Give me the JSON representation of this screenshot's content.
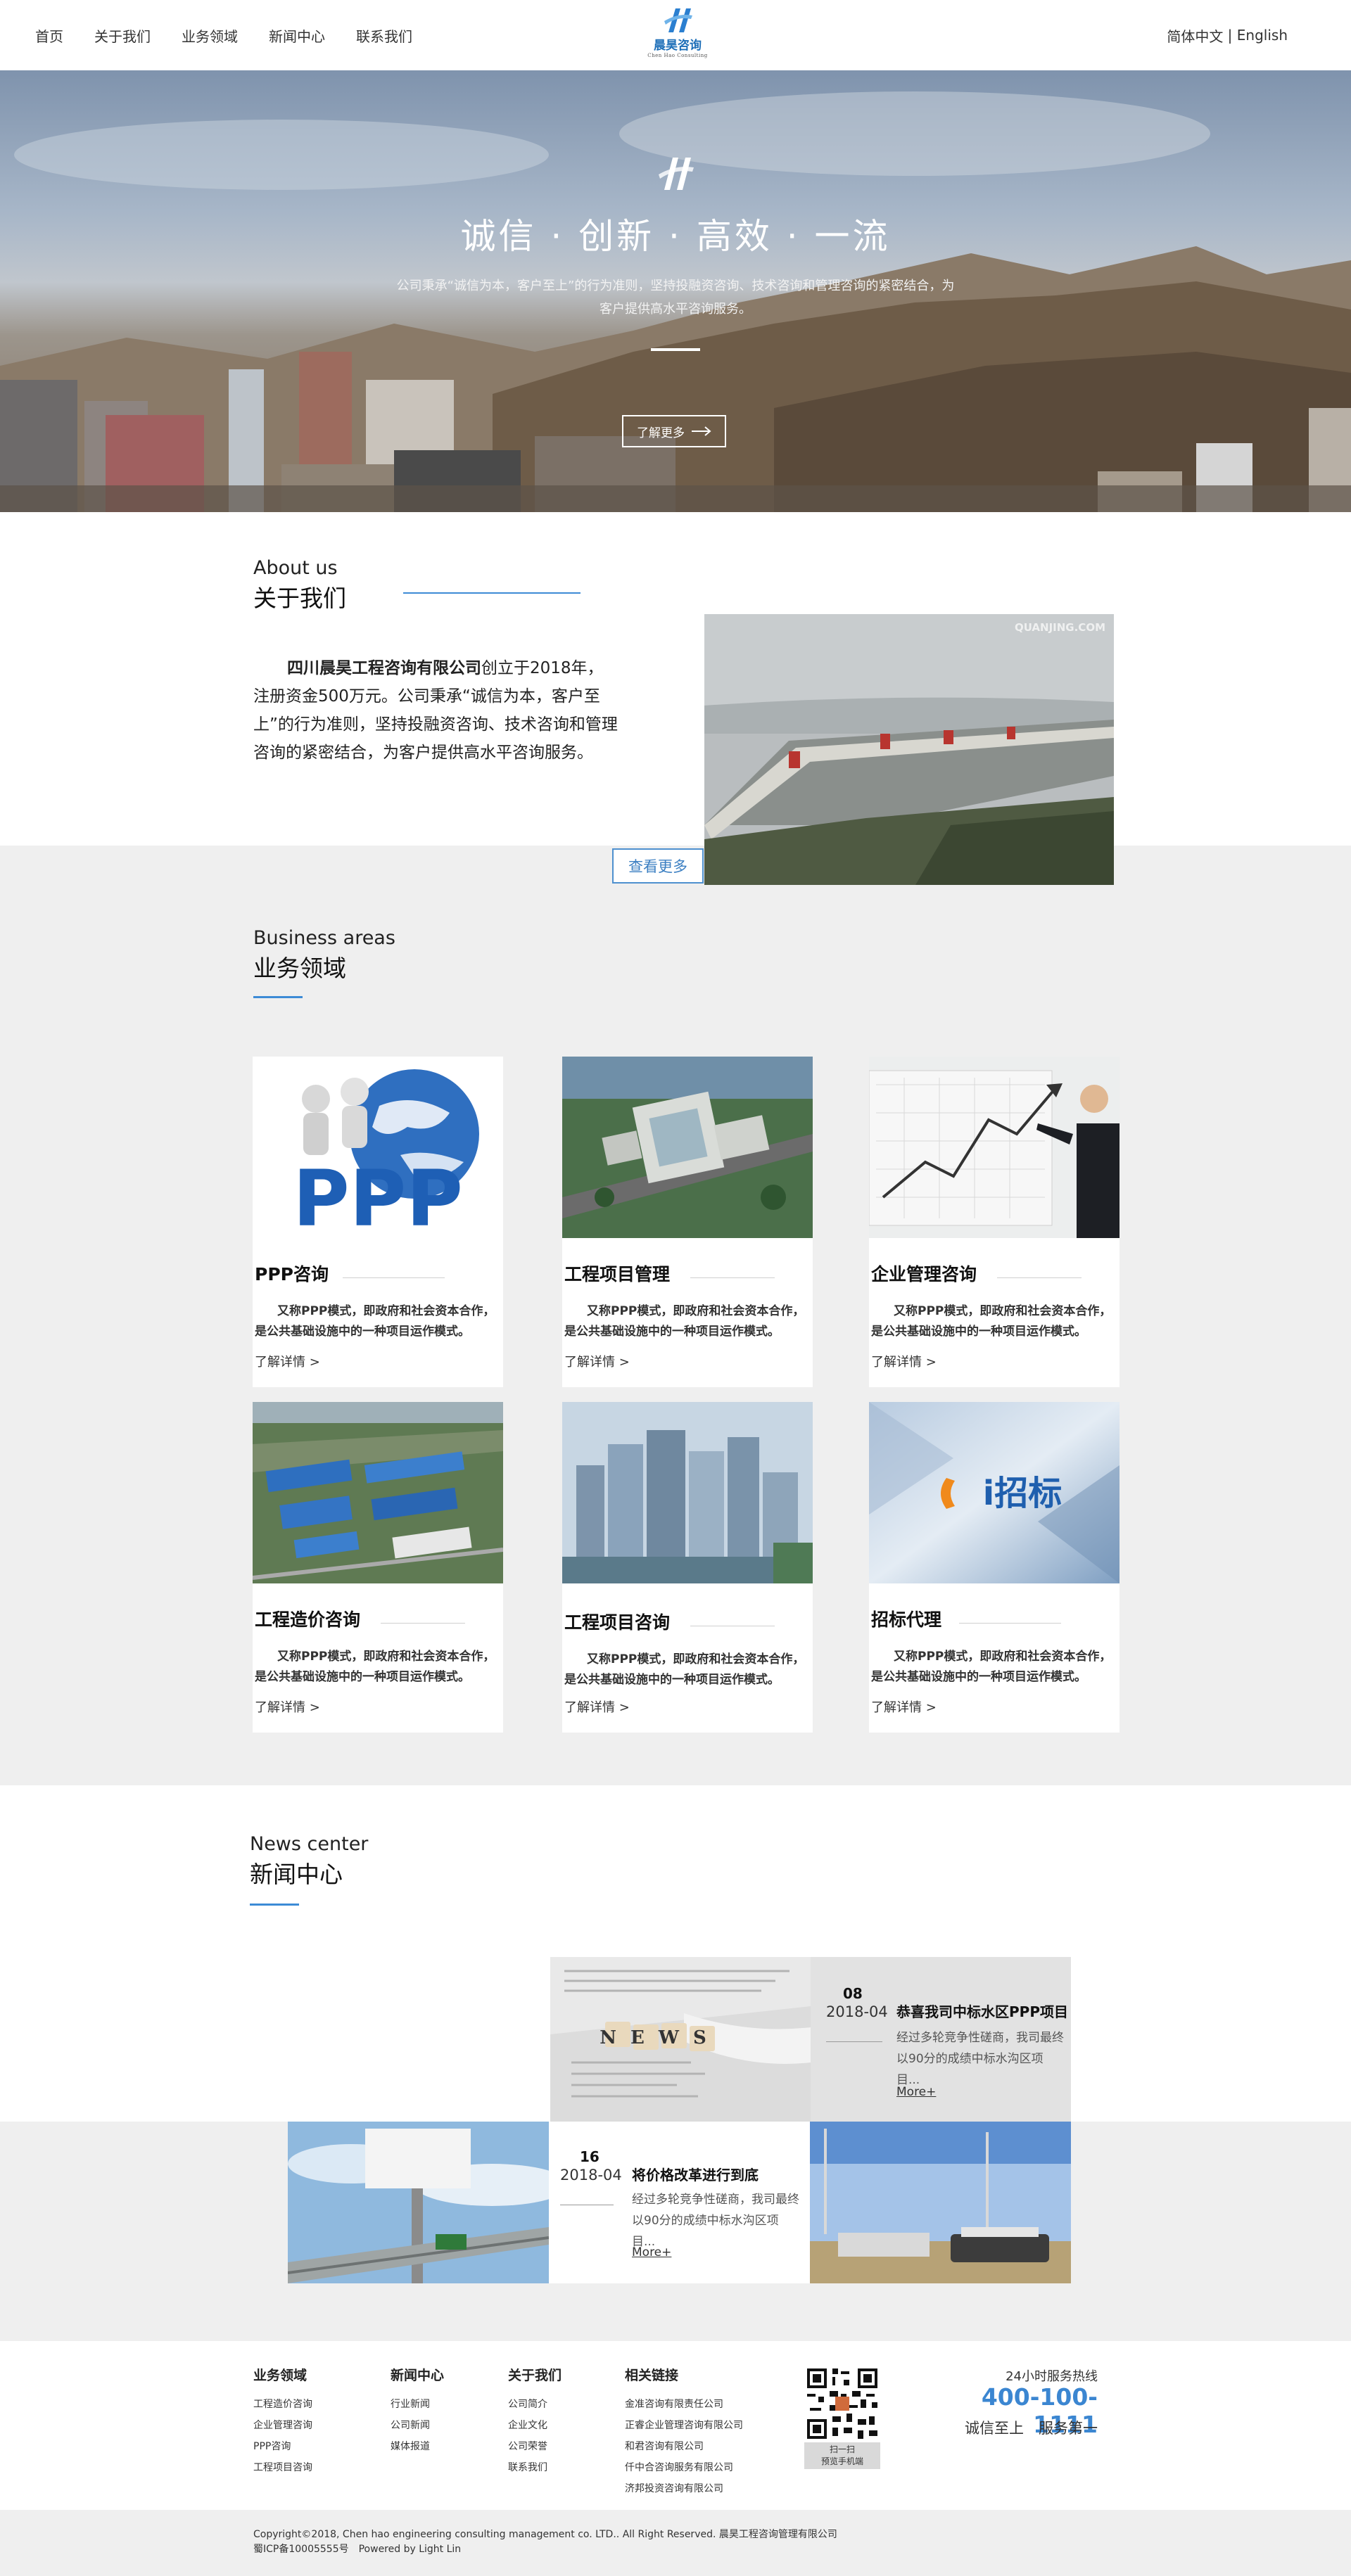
{
  "header": {
    "nav": [
      "首页",
      "关于我们",
      "业务领域",
      "新闻中心",
      "联系我们"
    ],
    "logo_text": "晨昊咨询",
    "logo_sub": "Chen Hao Consulting",
    "lang_cn": "简体中文",
    "lang_sep": " | ",
    "lang_en": "English"
  },
  "hero": {
    "title": "诚信 · 创新 · 高效 · 一流",
    "desc": "公司秉承“诚信为本，客户至上”的行为准则，坚持投融资咨询、技术咨询和管理咨询的紧密结合，为客户提供高水平咨询服务。",
    "button": "了解更多"
  },
  "about": {
    "en": "About us",
    "cn": "关于我们",
    "company": "四川晨昊工程咨询有限公司",
    "text": "创立于2018年，注册资金500万元。公司秉承“诚信为本，客户至上”的行为准则，坚持投融资咨询、技术咨询和管理咨询的紧密结合，为客户提供高水平咨询服务。",
    "watermark": "QUANJING.COM",
    "more": "查看更多"
  },
  "business": {
    "en": "Business areas",
    "cn": "业务领域",
    "desc": "又称PPP模式，即政府和社会资本合作，是公共基础设施中的一种项目运作模式。",
    "link": "了解详情 >",
    "cards": [
      {
        "title": "PPP咨询"
      },
      {
        "title": "工程项目管理"
      },
      {
        "title": "企业管理咨询"
      },
      {
        "title": "工程造价咨询"
      },
      {
        "title": "工程项目咨询"
      },
      {
        "title": "招标代理"
      }
    ],
    "ppp_text": "PPP",
    "bid_text": "i招标"
  },
  "news": {
    "en": "News center",
    "cn": "新闻中心",
    "img_word": "NEWS",
    "items": [
      {
        "day": "08",
        "month": "2018-04",
        "title": "恭喜我司中标水区PPP项目",
        "summary": "经过多轮竞争性磋商，我司最终以90分的成绩中标水沟区项目...",
        "more": "More+"
      },
      {
        "day": "16",
        "month": "2018-04",
        "title": "将价格改革进行到底",
        "summary": "经过多轮竞争性磋商，我司最终以90分的成绩中标水沟区项目...",
        "more": "More+"
      }
    ]
  },
  "footer": {
    "cols": [
      {
        "title": "业务领域",
        "items": [
          "工程造价咨询",
          "企业管理咨询",
          "PPP咨询",
          "工程项目咨询"
        ]
      },
      {
        "title": "新闻中心",
        "items": [
          "行业新闻",
          "公司新闻",
          "媒体报道"
        ]
      },
      {
        "title": "关于我们",
        "items": [
          "公司简介",
          "企业文化",
          "公司荣誉",
          "联系我们"
        ]
      },
      {
        "title": "相关链接",
        "items": [
          "金准咨询有限责任公司",
          "正睿企业管理咨询有限公司",
          "和君咨询有限公司",
          "仟中合咨询服务有限公司",
          "济邦投资咨询有限公司"
        ]
      }
    ],
    "qr_caption1": "扫一扫",
    "qr_caption2": "预览手机端",
    "hotline_label": "24小时服务热线",
    "hotline": "400-100-1111",
    "slogan": "诚信至上　服务第一",
    "copyright": "Copyright©2018, Chen hao engineering consulting management co. LTD.. All Right Reserved. 晨昊工程咨询管理有限公司",
    "icp": "蜀ICP备10005555号　Powered by Light Lin"
  },
  "colors": {
    "accent": "#3b86d1",
    "band": "#efefef"
  }
}
